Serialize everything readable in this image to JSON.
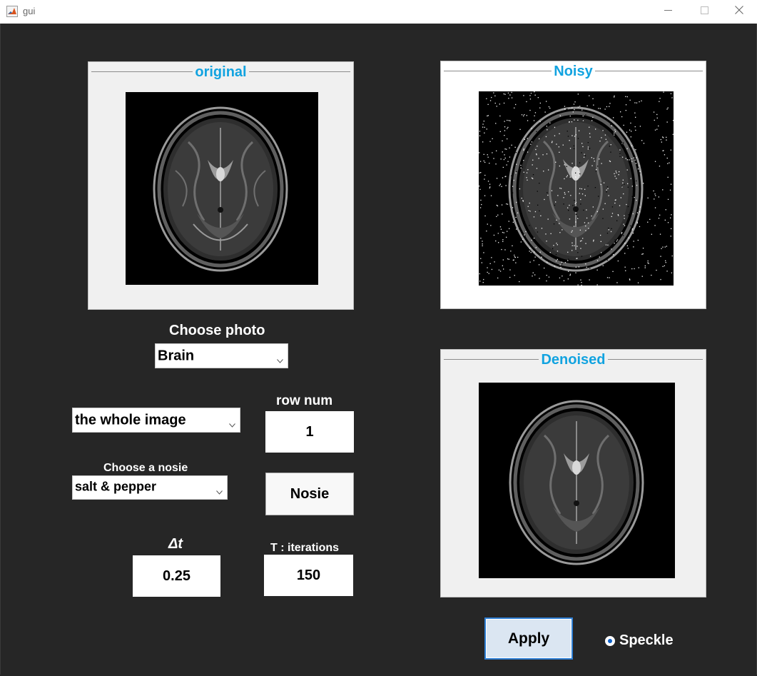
{
  "window": {
    "title": "gui",
    "minimize_glyph": "—",
    "maximize_glyph": "☐",
    "close_glyph": "✕"
  },
  "panels": {
    "original": {
      "title": "original"
    },
    "noisy": {
      "title": "Noisy"
    },
    "denoised": {
      "title": "Denoised"
    }
  },
  "controls": {
    "choose_photo_label": "Choose photo",
    "photo_dropdown_value": "Brain",
    "region_dropdown_value": "the whole image",
    "row_num_label": "row num",
    "row_num_value": "1",
    "choose_noise_label": "Choose a nosie",
    "noise_dropdown_value": "salt & pepper",
    "noise_button_label": "Nosie",
    "dt_label": "Δt",
    "dt_value": "0.25",
    "iterations_label": "T : iterations",
    "iterations_value": "150",
    "apply_button_label": "Apply",
    "speckle_label": "Speckle",
    "speckle_selected": true
  },
  "colors": {
    "background": "#262626",
    "panel_title": "#12a3e0",
    "apply_border": "#2f7fd4",
    "radio_accent": "#0f62c9"
  },
  "icons": {
    "app_icon": "matlab-icon",
    "dropdown": "chevron-down-icon"
  }
}
